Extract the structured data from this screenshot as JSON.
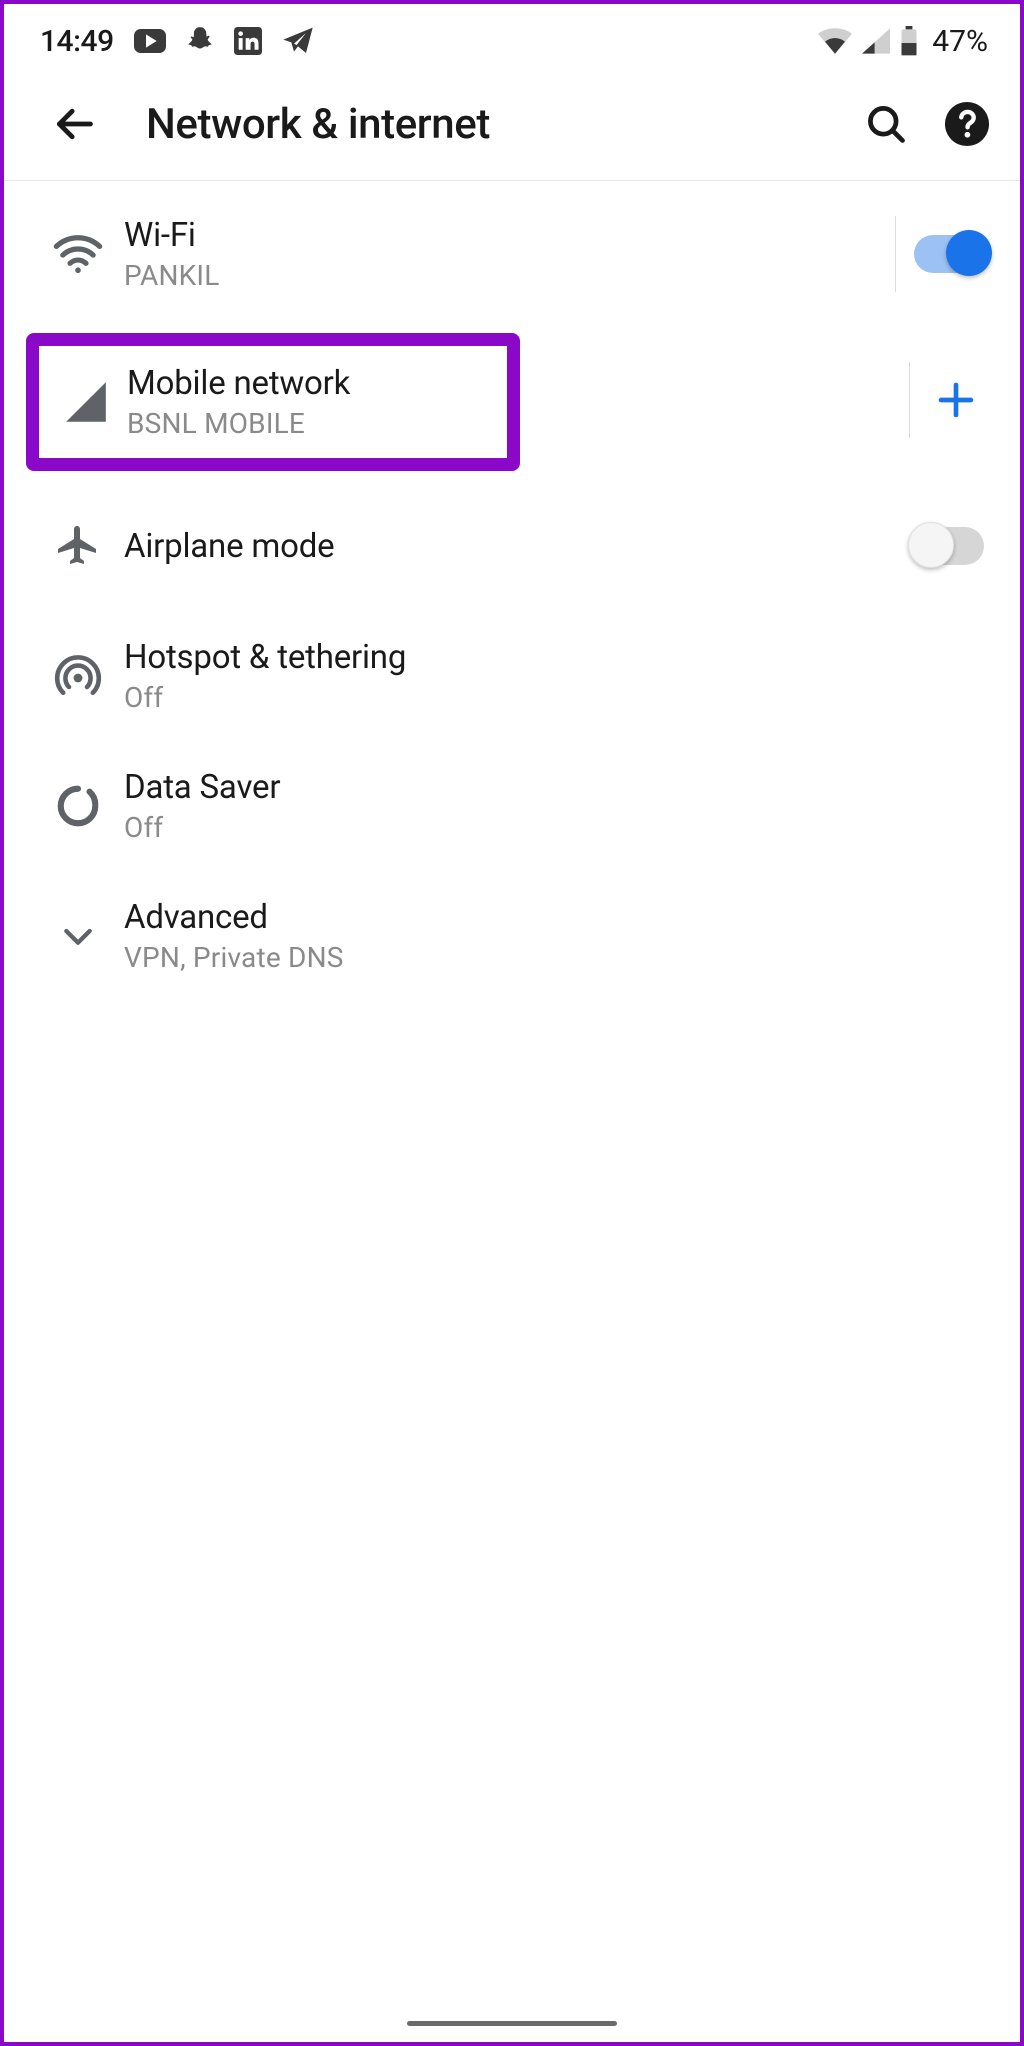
{
  "status": {
    "time": "14:49",
    "battery": "47%"
  },
  "header": {
    "title": "Network & internet"
  },
  "items": {
    "wifi": {
      "title": "Wi-Fi",
      "sub": "PANKIL",
      "toggle": true
    },
    "mobile": {
      "title": "Mobile network",
      "sub": "BSNL MOBILE"
    },
    "airplane": {
      "title": "Airplane mode",
      "toggle": false
    },
    "hotspot": {
      "title": "Hotspot & tethering",
      "sub": "Off"
    },
    "saver": {
      "title": "Data Saver",
      "sub": "Off"
    },
    "advanced": {
      "title": "Advanced",
      "sub": "VPN, Private DNS"
    }
  }
}
